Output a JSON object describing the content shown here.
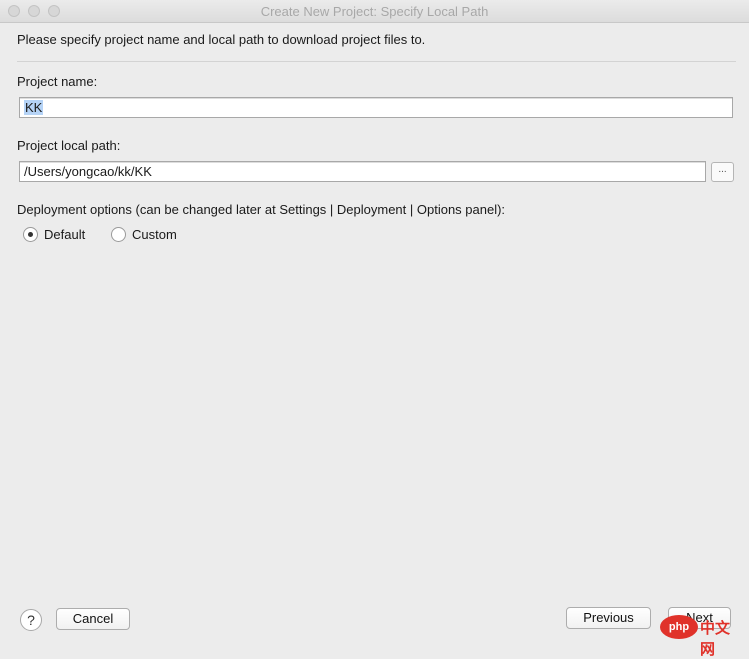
{
  "window": {
    "title": "Create New Project: Specify Local Path"
  },
  "intro_text": "Please specify project name and local path to download project files to.",
  "project_name": {
    "label": "Project name:",
    "value": "KK"
  },
  "local_path": {
    "label": "Project local path:",
    "value": "/Users/yongcao/kk/KK",
    "browse_label": "..."
  },
  "deployment": {
    "label": "Deployment options (can be changed later at Settings | Deployment | Options panel):",
    "options": [
      {
        "label": "Default",
        "selected": true
      },
      {
        "label": "Custom",
        "selected": false
      }
    ]
  },
  "footer": {
    "help_label": "?",
    "cancel_label": "Cancel",
    "previous_label": "Previous",
    "next_label": "Next"
  },
  "watermark": {
    "badge": "php",
    "text": "中文网"
  }
}
